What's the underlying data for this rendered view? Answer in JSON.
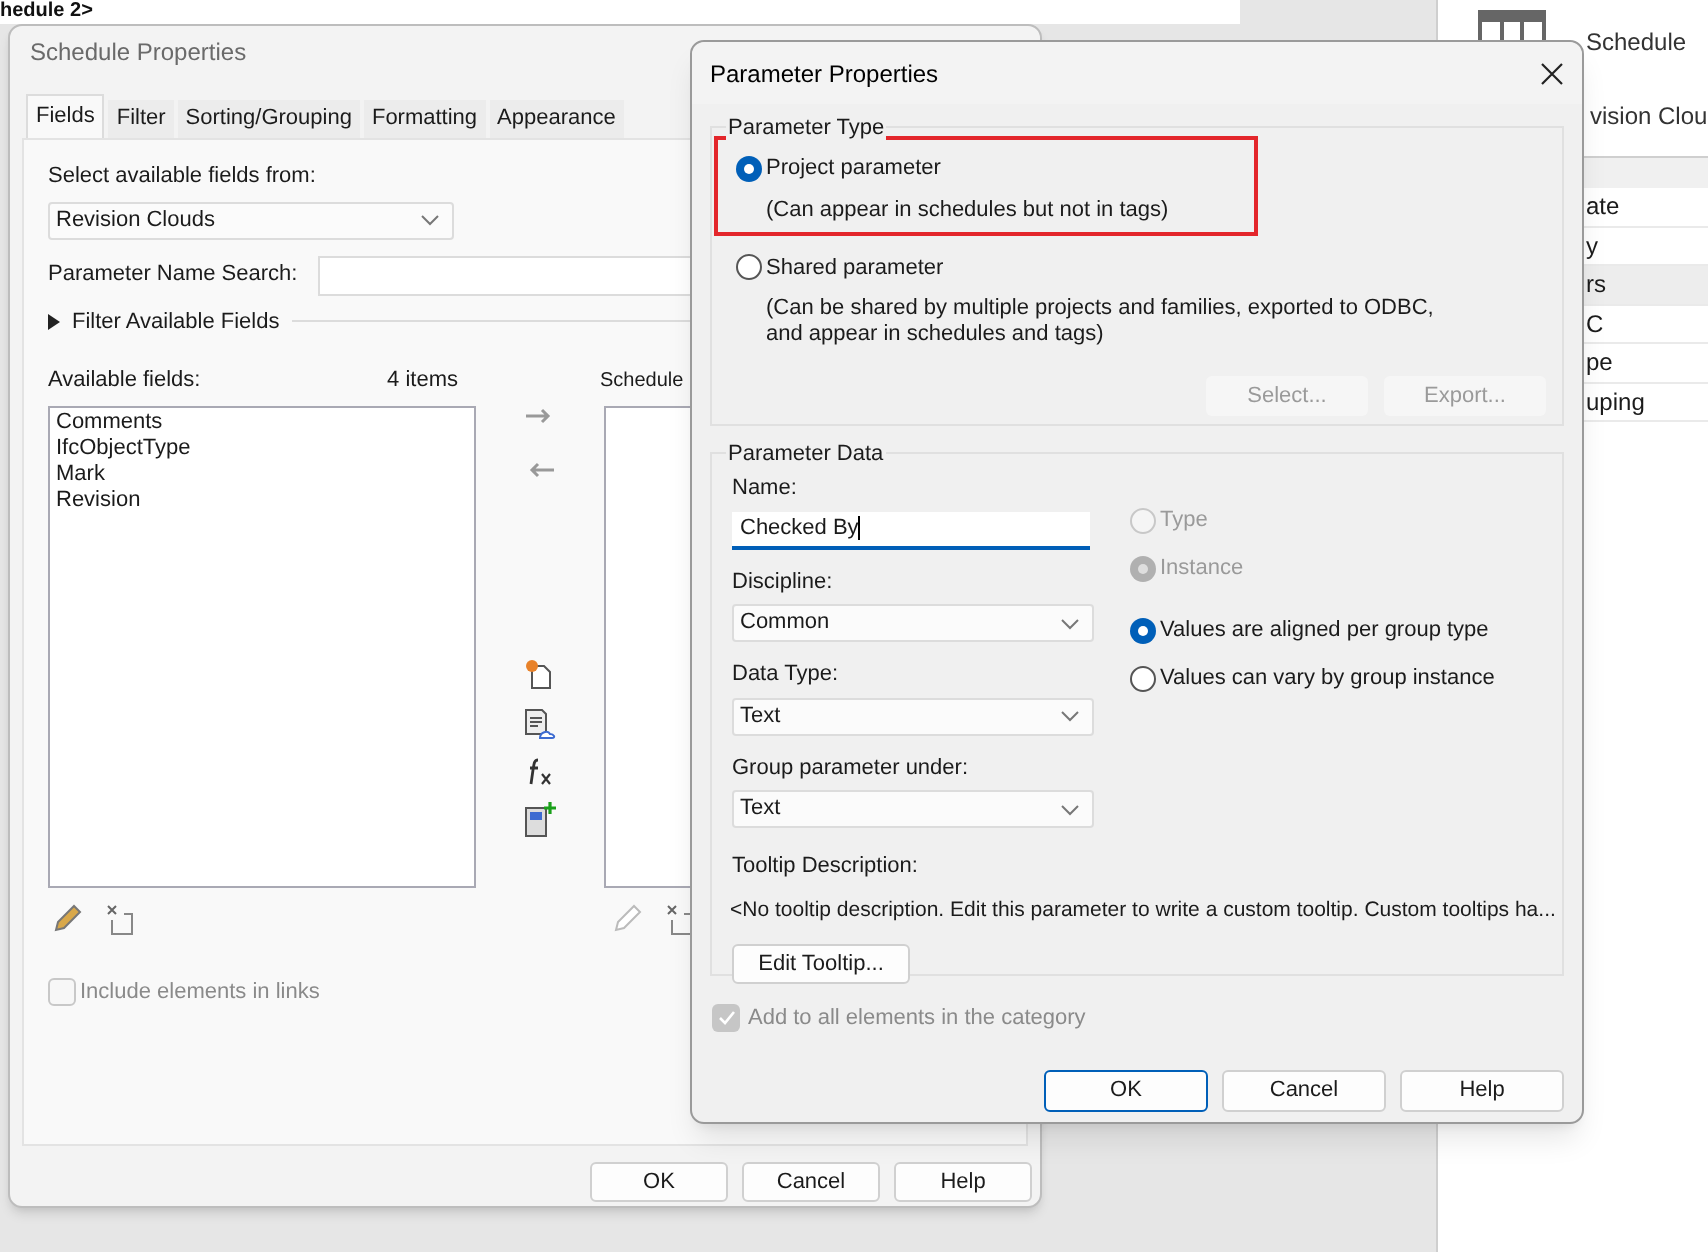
{
  "background": {
    "tab_title": "hedule 2>",
    "browser": {
      "title": "Schedule",
      "subtitle": "vision Clou",
      "rows": [
        {
          "text": "ate",
          "header": false
        },
        {
          "text": "y",
          "header": false
        },
        {
          "text": "rs",
          "header": true
        },
        {
          "text": "C",
          "header": false
        },
        {
          "text": "pe",
          "header": false
        },
        {
          "text": "uping",
          "header": false
        }
      ]
    }
  },
  "schedule_properties": {
    "title": "Schedule Properties",
    "tabs": [
      {
        "label": "Fields",
        "selected": true
      },
      {
        "label": "Filter",
        "selected": false
      },
      {
        "label": "Sorting/Grouping",
        "selected": false
      },
      {
        "label": "Formatting",
        "selected": false
      },
      {
        "label": "Appearance",
        "selected": false
      }
    ],
    "source_label": "Select available fields from:",
    "source": "Revision Clouds",
    "search_label": "Parameter Name Search:",
    "filter_toggle": {
      "label": "Filter Available Fields",
      "expanded": false
    },
    "available_label": "Available fields:",
    "available_count": "4 items",
    "available_fields": [
      "Comments",
      "IfcObjectType",
      "Mark",
      "Revision"
    ],
    "scheduled_label": "Schedule",
    "include_links": {
      "label": "Include elements in links",
      "checked": false,
      "disabled": true
    },
    "buttons": [
      "OK",
      "Cancel",
      "Help"
    ]
  },
  "parameter_properties": {
    "title": "Parameter Properties",
    "parameter_type": {
      "legend": "Parameter Type",
      "options": [
        {
          "label": "Project parameter",
          "description": "(Can appear in schedules but not in tags)",
          "selected": true,
          "highlighted": true
        },
        {
          "label": "Shared parameter",
          "description": "(Can be shared by multiple projects and families, exported to ODBC, and appear in schedules and tags)",
          "selected": false,
          "highlighted": false
        }
      ],
      "buttons": [
        {
          "label": "Select...",
          "disabled": true
        },
        {
          "label": "Export...",
          "disabled": true
        }
      ]
    },
    "parameter_data": {
      "legend": "Parameter Data",
      "name": {
        "label": "Name:",
        "value": "Checked By"
      },
      "discipline": {
        "label": "Discipline:",
        "value": "Common"
      },
      "data_type": {
        "label": "Data Type:",
        "value": "Text"
      },
      "group_under": {
        "label": "Group parameter under:",
        "value": "Text"
      },
      "scope_options": [
        {
          "label": "Type",
          "selected": false,
          "disabled": true
        },
        {
          "label": "Instance",
          "selected": true,
          "disabled": true
        }
      ],
      "group_options": [
        {
          "label": "Values are aligned per group type",
          "selected": true,
          "disabled": false
        },
        {
          "label": "Values can vary by group instance",
          "selected": false,
          "disabled": false
        }
      ],
      "tooltip_label": "Tooltip Description:",
      "tooltip": "<No tooltip description. Edit this parameter to write a custom tooltip. Custom tooltips ha...",
      "edit_tooltip": "Edit Tooltip..."
    },
    "add_to_all": {
      "label": "Add to all elements in the category",
      "checked": true,
      "disabled": true
    },
    "buttons": [
      {
        "label": "OK",
        "default": true
      },
      {
        "label": "Cancel",
        "default": false
      },
      {
        "label": "Help",
        "default": false
      }
    ]
  }
}
